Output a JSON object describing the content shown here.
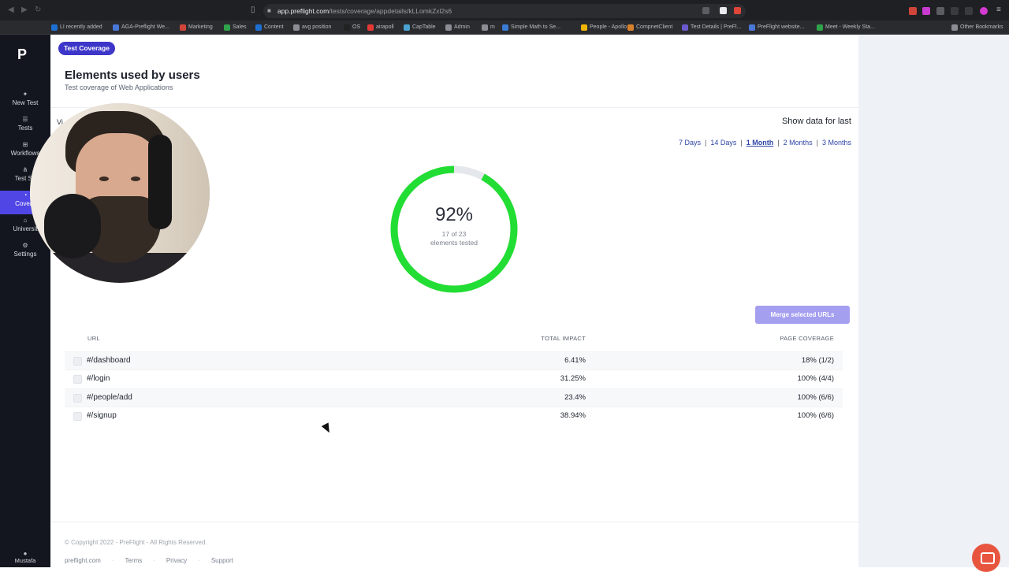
{
  "browser": {
    "url_host": "app.preflight.com",
    "url_path": "/tests/coverage/appdetails/kLLomkZxl2s6",
    "bookmarks": [
      {
        "label": "LI recently added",
        "color": "#1d6fd1"
      },
      {
        "label": "AGA-Preflight We...",
        "color": "#4a78d8"
      },
      {
        "label": "Marketing",
        "color": "#d0453a"
      },
      {
        "label": "Sales",
        "color": "#2fa34a"
      },
      {
        "label": "Content",
        "color": "#1d6fd1"
      },
      {
        "label": "avg position",
        "color": "#8a8d93"
      },
      {
        "label": "OS",
        "color": "#222"
      },
      {
        "label": "airapoll",
        "color": "#e53935"
      },
      {
        "label": "CapTable",
        "color": "#4aa3d1"
      },
      {
        "label": "Admin",
        "color": "#8a8d93"
      },
      {
        "label": "m",
        "color": "#8a8d93"
      },
      {
        "label": "Simple Math to Se...",
        "color": "#3a7bd5"
      },
      {
        "label": "People - Apollo",
        "color": "#f2b705"
      },
      {
        "label": "CompnetClient",
        "color": "#d9802a"
      },
      {
        "label": "Test Details | PreFl...",
        "color": "#6a5acd"
      },
      {
        "label": "PreFlight website...",
        "color": "#4a78d8"
      },
      {
        "label": "Meet - Weekly Sta...",
        "color": "#2fa34a"
      },
      {
        "label": "Other Bookmarks",
        "color": "#8a8d93"
      }
    ]
  },
  "sidebar": {
    "items": [
      {
        "label": "New Test",
        "icon": "plus-icon",
        "glyph": "✦"
      },
      {
        "label": "Tests",
        "icon": "list-icon",
        "glyph": "☰"
      },
      {
        "label": "Workflows",
        "icon": "workflow-icon",
        "glyph": "⊞"
      },
      {
        "label": "Test Su",
        "icon": "suite-icon",
        "glyph": "⋔"
      },
      {
        "label": "Covera",
        "icon": "coverage-icon",
        "glyph": "◔"
      },
      {
        "label": "Universit",
        "icon": "university-icon",
        "glyph": "⌂"
      },
      {
        "label": "Settings",
        "icon": "gear-icon",
        "glyph": "⚙"
      }
    ],
    "active_index": 4,
    "user": "Mustafa"
  },
  "header": {
    "badge": "Test Coverage",
    "title": "Elements used by users",
    "subtitle": "Test coverage of Web Applications",
    "partial_label": "Vi"
  },
  "range": {
    "label": "Show data for last",
    "options": [
      "7 Days",
      "14 Days",
      "1 Month",
      "2 Months",
      "3 Months"
    ],
    "selected": "1 Month"
  },
  "coverage": {
    "percent_text": "92%",
    "percent_value": 0.92,
    "tested_text": "17 of 23",
    "tested_suffix": "elements tested",
    "ring_color": "#22dd33",
    "track_color": "#e4e7eb"
  },
  "merge_button": "Merge selected URLs",
  "table": {
    "headers": {
      "url": "URL",
      "impact": "TOTAL IMPACT",
      "coverage": "PAGE COVERAGE"
    },
    "rows": [
      {
        "url": "#/dashboard",
        "impact": "6.41%",
        "coverage": "18% (1/2)"
      },
      {
        "url": "#/login",
        "impact": "31.25%",
        "coverage": "100% (4/4)"
      },
      {
        "url": "#/people/add",
        "impact": "23.4%",
        "coverage": "100% (6/6)"
      },
      {
        "url": "#/signup",
        "impact": "38.94%",
        "coverage": "100% (6/6)"
      }
    ]
  },
  "footer": {
    "copyright": "© Copyright 2022 - PreFlight - All Rights Reserved.",
    "links": [
      "preflight.com",
      "Terms",
      "Privacy",
      "Support"
    ]
  }
}
